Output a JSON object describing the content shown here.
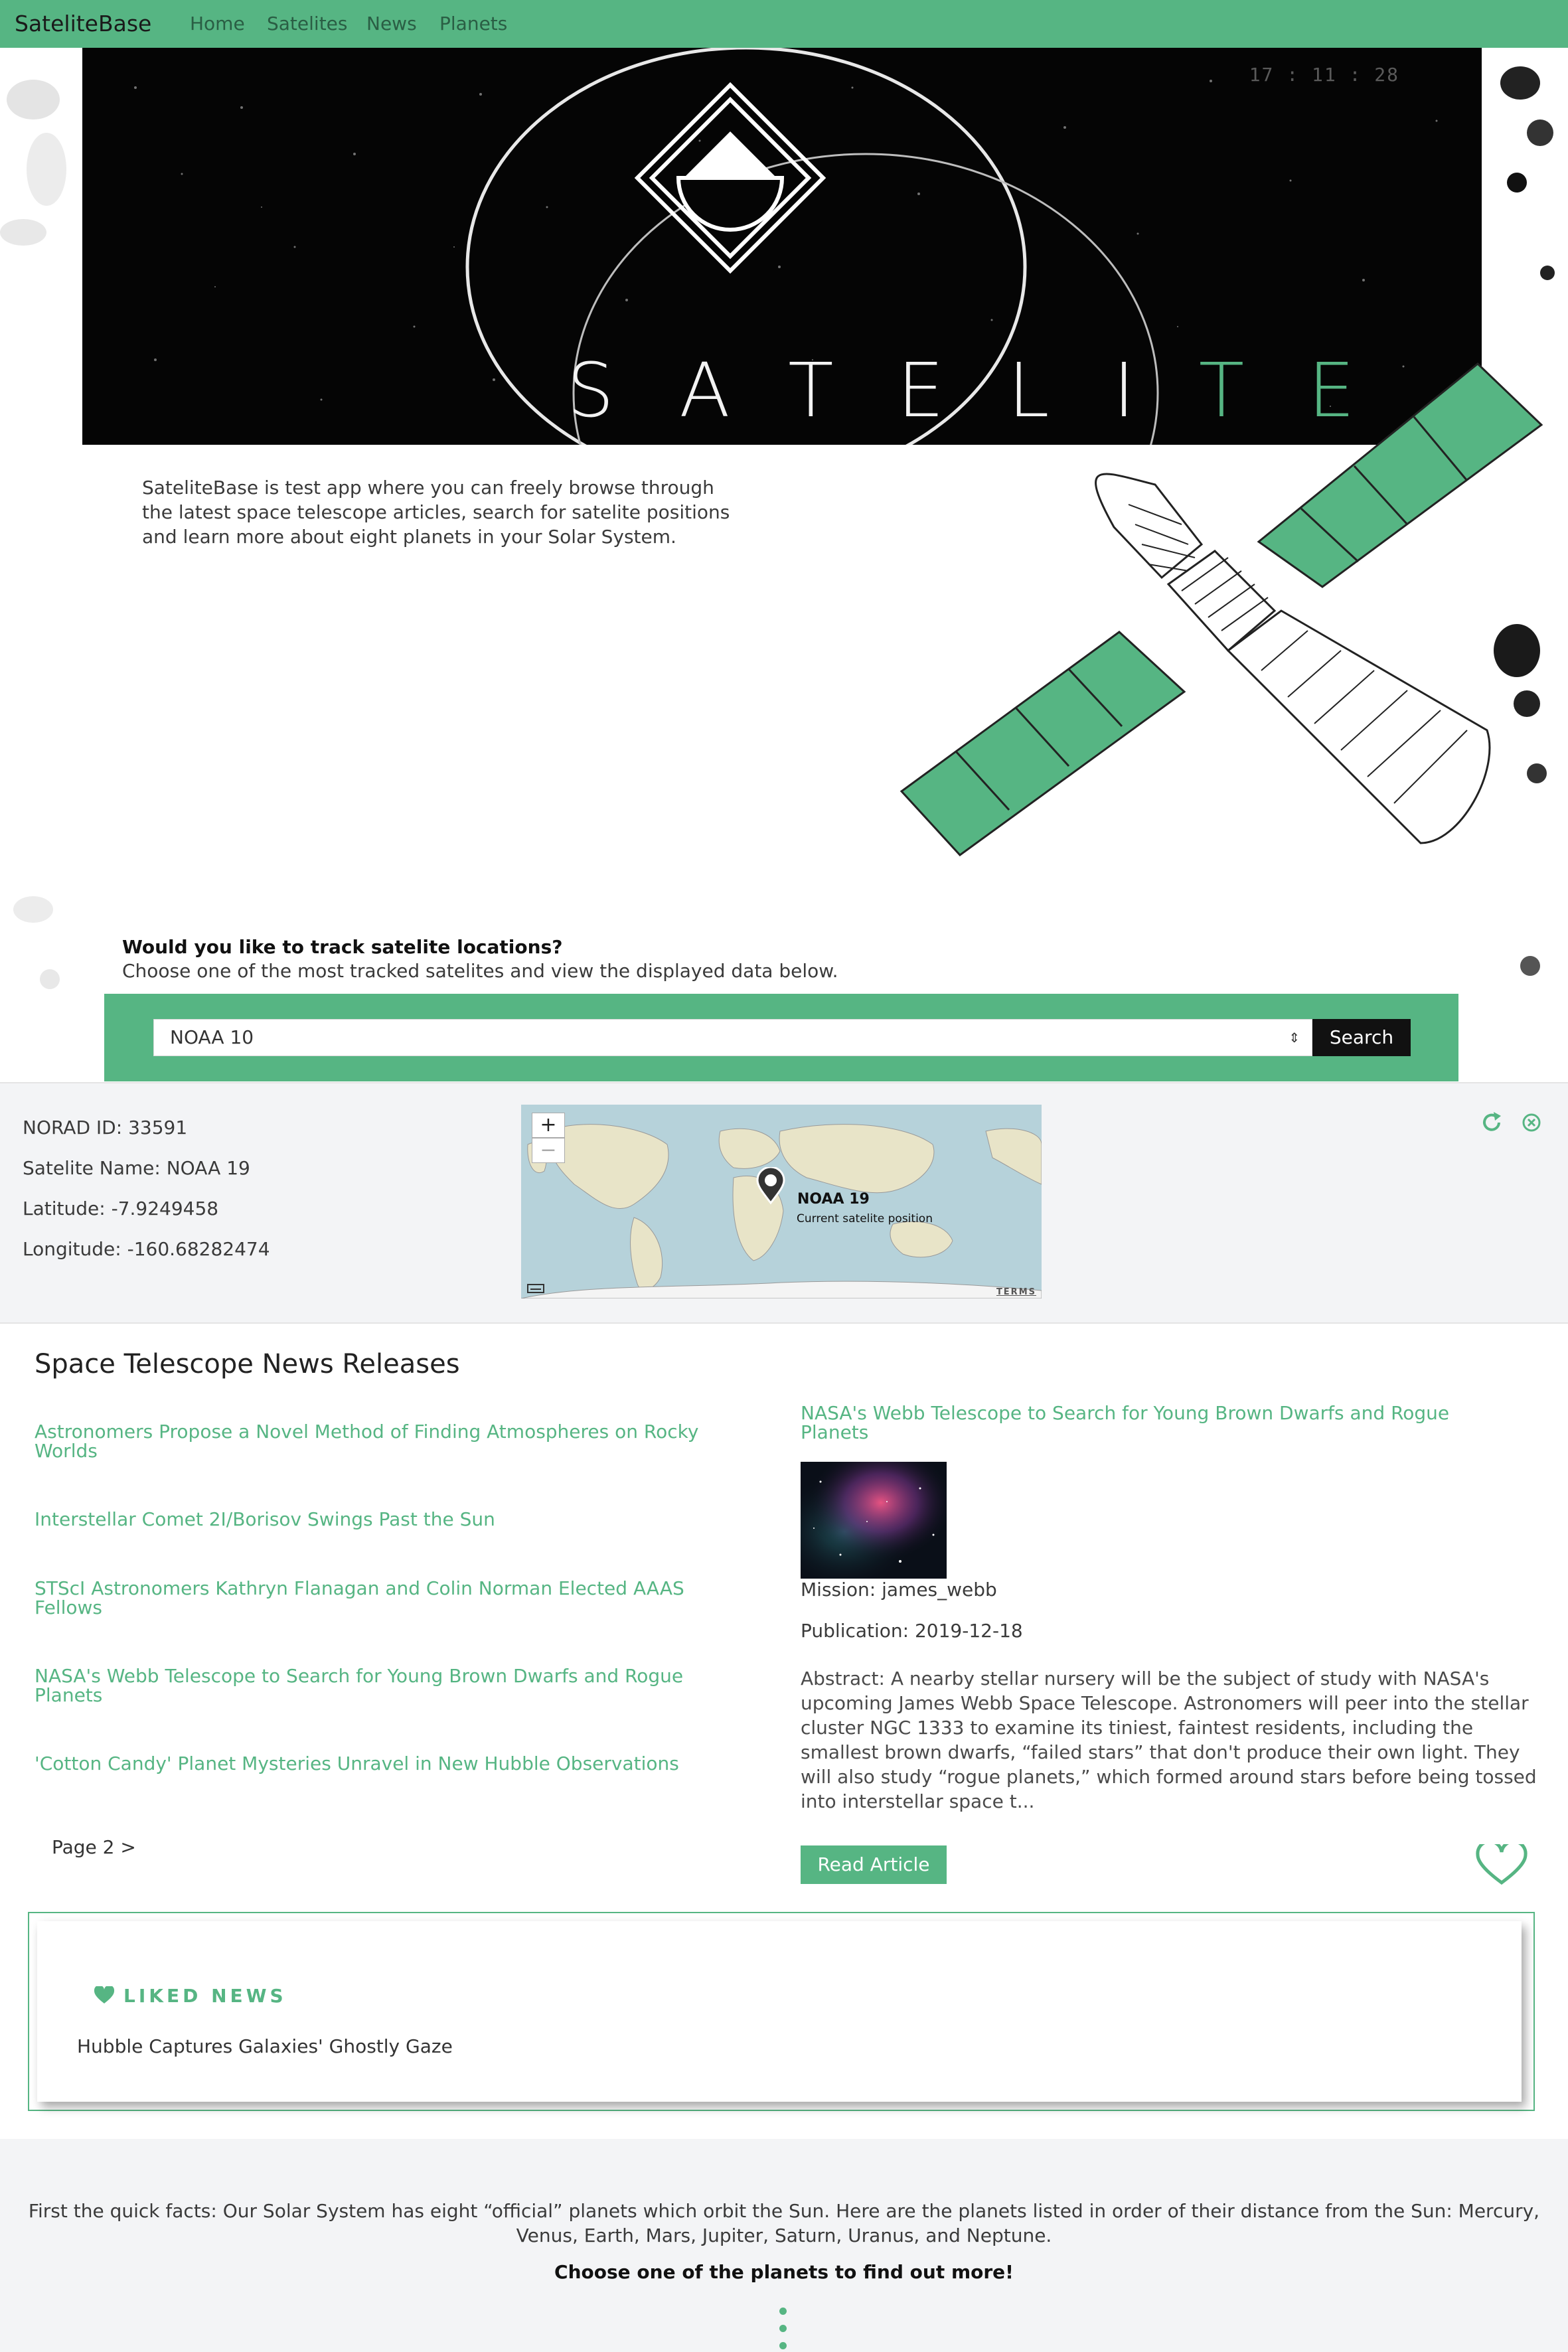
{
  "nav": {
    "brand": "SateliteBase",
    "links": [
      "Home",
      "Satelites",
      "News",
      "Planets"
    ]
  },
  "hero": {
    "clock": "17 : 11 : 28",
    "word_white": "SATELI",
    "word_green": "TE"
  },
  "intro": {
    "text": "SateliteBase is test app where you can freely browse through the latest space telescope articles, search for satelite positions and learn more about eight planets in your Solar System."
  },
  "track": {
    "question": "Would you like to track satelite locations?",
    "subtitle": "Choose one of the most tracked satelites and view the displayed data below.",
    "selected": "NOAA 10",
    "search_label": "Search"
  },
  "satellite": {
    "norad": "NORAD ID: 33591",
    "name": "Satelite Name: NOAA 19",
    "latitude": "Latitude: -7.9249458",
    "longitude": "Longitude: -160.68282474",
    "map_label": "NOAA 19",
    "map_sublabel": "Current satelite position",
    "map_terms": "TERMS",
    "zoom_in": "+",
    "zoom_out": "−"
  },
  "news": {
    "title": "Space Telescope News Releases",
    "items": [
      "Astronomers Propose a Novel Method of Finding Atmospheres on Rocky Worlds",
      "Interstellar Comet 2I/Borisov Swings Past the Sun",
      "STScI Astronomers Kathryn Flanagan and Colin Norman Elected AAAS Fellows",
      "NASA's Webb Telescope to Search for Young Brown Dwarfs and Rogue Planets",
      "'Cotton Candy' Planet Mysteries Unravel in New Hubble Observations"
    ],
    "page_nav": "Page 2 >",
    "article": {
      "title": "NASA's Webb Telescope to Search for Young Brown Dwarfs and Rogue Planets",
      "mission": "Mission: james_webb",
      "publication": "Publication: 2019-12-18",
      "abstract": "Abstract: A nearby stellar nursery will be the subject of study with NASA's upcoming James Webb Space Telescope. Astronomers will peer into the stellar cluster NGC 1333 to examine its tiniest, faintest residents, including the smallest brown dwarfs, “failed stars” that don't produce their own light. They will also study “rogue planets,” which formed around stars before being tossed into interstellar space t...",
      "read_label": "Read Article"
    }
  },
  "liked": {
    "title": "LIKED NEWS",
    "items": [
      "Hubble Captures Galaxies' Ghostly Gaze"
    ]
  },
  "planets": {
    "facts": "First the quick facts: Our Solar System has eight “official” planets which orbit the Sun. Here are the planets listed in order of their distance from the Sun: Mercury, Venus, Earth, Mars, Jupiter, Saturn, Uranus, and Neptune.",
    "cta": "Choose one of the planets to find out more!"
  },
  "colors": {
    "accent": "#56b583",
    "dark": "#111111",
    "panel": "#f3f4f6"
  }
}
